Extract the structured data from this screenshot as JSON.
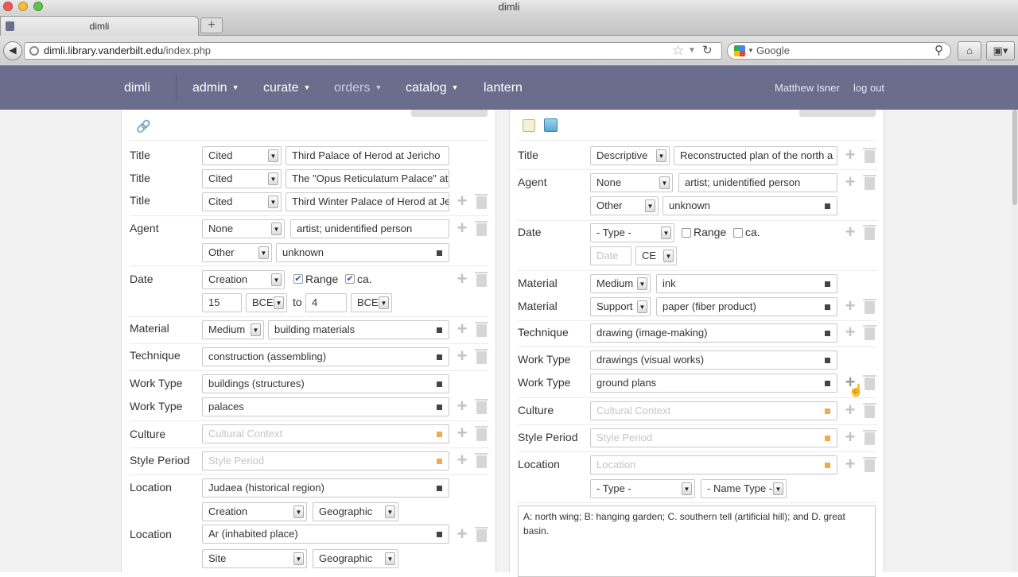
{
  "window": {
    "title": "dimli"
  },
  "browser": {
    "tab_title": "dimli",
    "new_tab": "+",
    "url_host": "dimli.library.vanderbilt.edu",
    "url_path": "/index.php",
    "search_placeholder": "Google"
  },
  "appnav": {
    "brand": "dimli",
    "admin": "admin",
    "curate": "curate",
    "orders": "orders",
    "catalog": "catalog",
    "lantern": "lantern",
    "user": "Matthew Isner",
    "logout": "log out"
  },
  "left": {
    "title1": {
      "label": "Title",
      "type": "Cited",
      "value": "Third Palace of Herod at Jericho"
    },
    "title2": {
      "label": "Title",
      "type": "Cited",
      "value": "The \"Opus Reticulatum Palace\" at"
    },
    "title3": {
      "label": "Title",
      "type": "Cited",
      "value": "Third Winter Palace of Herod at Je"
    },
    "agent": {
      "label": "Agent",
      "type": "None",
      "value": "artist; unidentified person",
      "type2": "Other",
      "value2": "unknown"
    },
    "date": {
      "label": "Date",
      "type": "Creation",
      "range": "Range",
      "ca": "ca.",
      "from": "15",
      "era1": "BCE",
      "to": "to",
      "until": "4",
      "era2": "BCE"
    },
    "material": {
      "label": "Material",
      "type": "Medium",
      "value": "building materials"
    },
    "technique": {
      "label": "Technique",
      "value": "construction (assembling)"
    },
    "worktype1": {
      "label": "Work Type",
      "value": "buildings (structures)"
    },
    "worktype2": {
      "label": "Work Type",
      "value": "palaces"
    },
    "culture": {
      "label": "Culture",
      "placeholder": "Cultural Context"
    },
    "style": {
      "label": "Style Period",
      "placeholder": "Style Period"
    },
    "location1": {
      "label": "Location",
      "value": "Judaea (historical region)",
      "type": "Creation",
      "nametype": "Geographic"
    },
    "location2": {
      "label": "Location",
      "value": "Ar (inhabited place)",
      "type": "Site",
      "nametype": "Geographic"
    }
  },
  "right": {
    "title": {
      "label": "Title",
      "type": "Descriptive",
      "value": "Reconstructed plan of the north a"
    },
    "agent": {
      "label": "Agent",
      "type": "None",
      "value": "artist; unidentified person",
      "type2": "Other",
      "value2": "unknown"
    },
    "date": {
      "label": "Date",
      "type": "- Type -",
      "range": "Range",
      "ca": "ca.",
      "date_placeholder": "Date",
      "era": "CE"
    },
    "material1": {
      "label": "Material",
      "type": "Medium",
      "value": "ink"
    },
    "material2": {
      "label": "Material",
      "type": "Support",
      "value": "paper (fiber product)"
    },
    "technique": {
      "label": "Technique",
      "value": "drawing (image-making)"
    },
    "worktype1": {
      "label": "Work Type",
      "value": "drawings (visual works)"
    },
    "worktype2": {
      "label": "Work Type",
      "value": "ground plans"
    },
    "culture": {
      "label": "Culture",
      "placeholder": "Cultural Context"
    },
    "style": {
      "label": "Style Period",
      "placeholder": "Style Period"
    },
    "location": {
      "label": "Location",
      "placeholder": "Location",
      "type": "- Type -",
      "nametype": "- Name Type -"
    },
    "description": "A: north wing; B: hanging garden; C. southern tell (artificial hill); and D. great basin."
  },
  "icons": {
    "arrow": "▾",
    "plus": "+"
  },
  "colors": {
    "nav_bg": "#6b6d8c",
    "marker_dark": "#444444",
    "marker_orange": "#f3a94d",
    "check_blue": "#2c5ab5"
  }
}
